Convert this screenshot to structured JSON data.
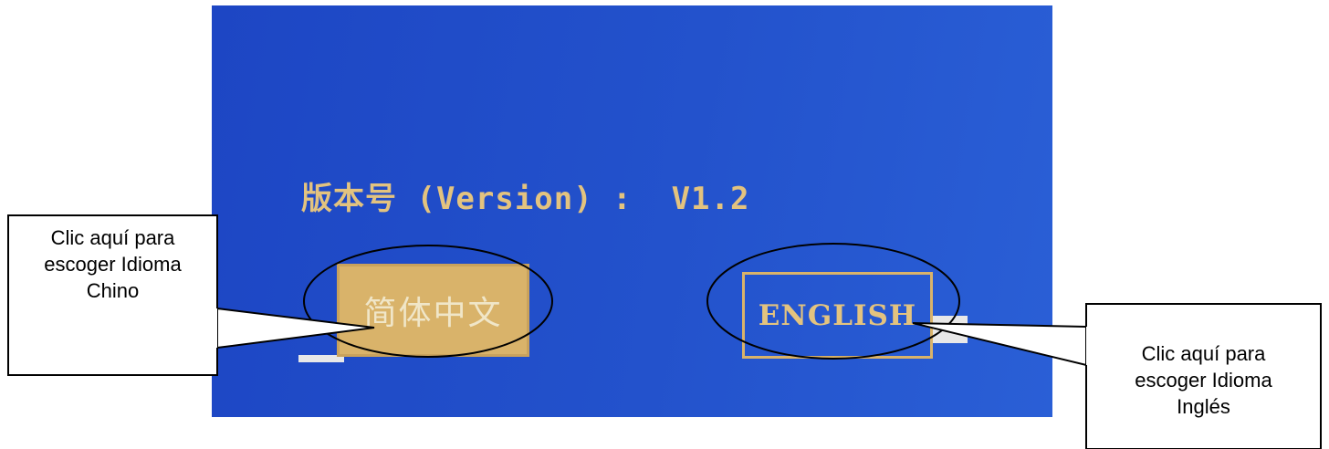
{
  "screen": {
    "version_line": "版本号 (Version) :  V1.2",
    "buttons": {
      "chinese_label": "简体中文",
      "english_label": "ENGLISH"
    }
  },
  "callouts": {
    "left": "Clic aquí para escoger Idioma Chino",
    "right": "Clic aquí para escoger Idioma Inglés"
  },
  "colors": {
    "screen_blue": "#2352cc",
    "text_gold": "#e3c37f",
    "button_fill": "#d9b36a",
    "callout_bg": "#ffffff",
    "callout_border": "#000000"
  }
}
